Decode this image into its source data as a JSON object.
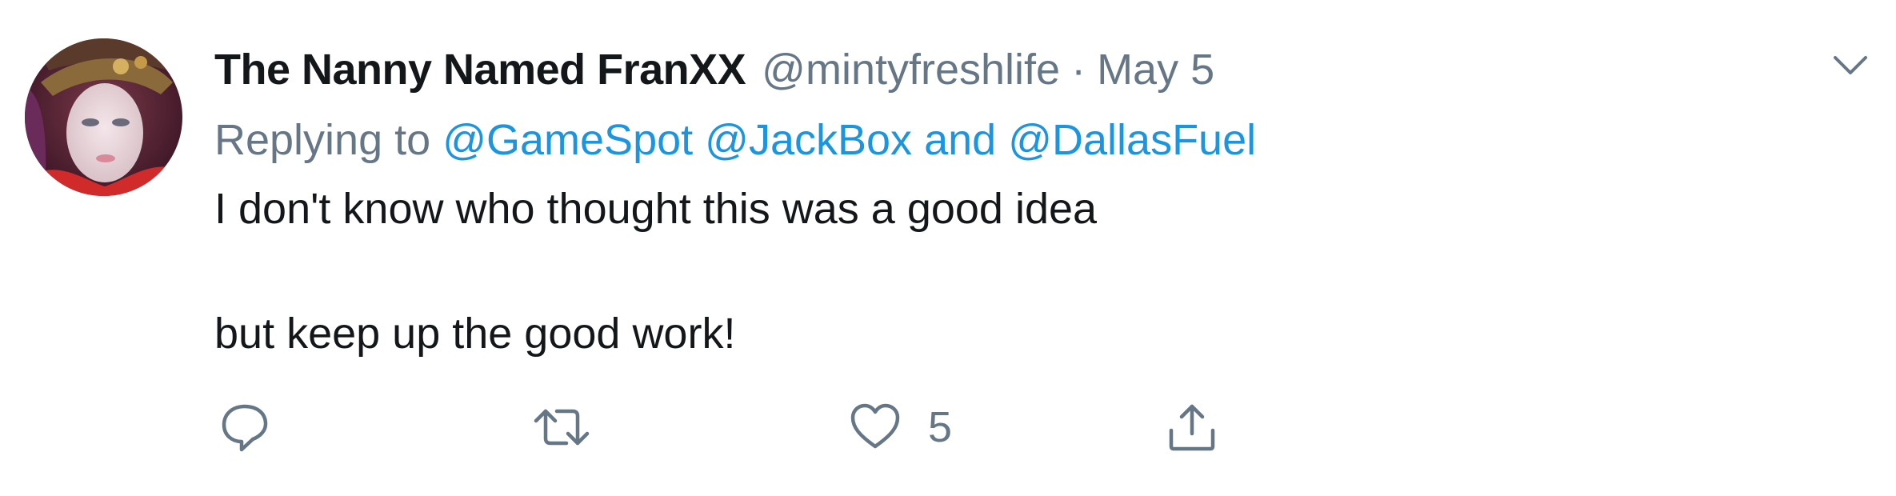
{
  "tweet": {
    "display_name": "The Nanny Named FranXX",
    "handle": "@mintyfreshlife",
    "separator": "·",
    "date": "May 5",
    "replying_to_label": "Replying to",
    "mentions": [
      "@GameSpot",
      "@JackBox",
      "@DallasFuel"
    ],
    "mention_conjunction": "and",
    "body_lines": [
      "I don't know who thought this was a good idea",
      "but keep up the good work!"
    ],
    "like_count": "5"
  },
  "icons": {
    "reply": "reply-icon",
    "retweet": "retweet-icon",
    "like": "heart-icon",
    "share": "share-icon",
    "menu": "chevron-down-icon"
  },
  "colors": {
    "link": "#1b95e0",
    "secondary_text": "#657786",
    "primary_text": "#14171a"
  }
}
